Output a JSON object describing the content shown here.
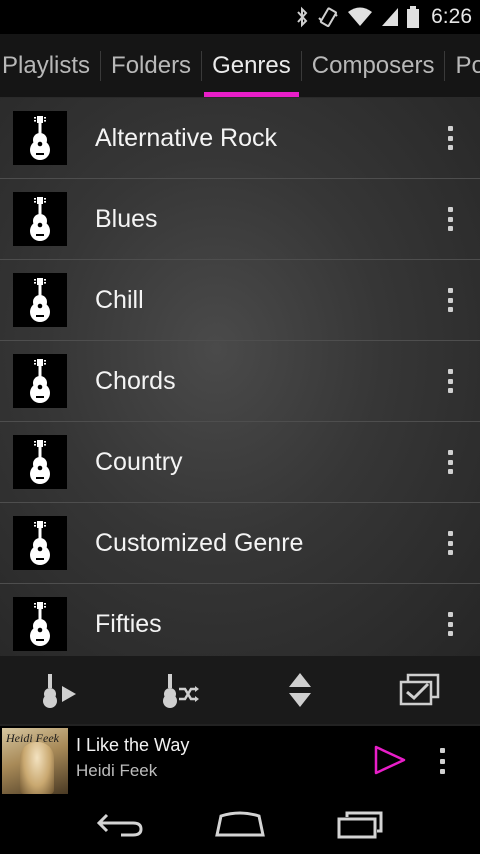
{
  "status_bar": {
    "time": "6:26",
    "icons": [
      "bluetooth-icon",
      "vibrate-icon",
      "wifi-icon",
      "signal-icon",
      "battery-icon"
    ]
  },
  "tabs": [
    {
      "label": "Playlists",
      "active": false
    },
    {
      "label": "Folders",
      "active": false
    },
    {
      "label": "Genres",
      "active": true
    },
    {
      "label": "Composers",
      "active": false
    },
    {
      "label": "Podcasts",
      "active": false
    }
  ],
  "colors": {
    "accent": "#e81ec8",
    "list_background": "#363636",
    "row_divider": "#4e4e4e"
  },
  "genres": [
    {
      "label": "Alternative Rock",
      "icon": "guitar-icon"
    },
    {
      "label": "Blues",
      "icon": "guitar-icon"
    },
    {
      "label": "Chill",
      "icon": "guitar-icon"
    },
    {
      "label": "Chords",
      "icon": "guitar-icon"
    },
    {
      "label": "Country",
      "icon": "guitar-icon"
    },
    {
      "label": "Customized Genre",
      "icon": "guitar-icon"
    },
    {
      "label": "Fifties",
      "icon": "guitar-icon"
    }
  ],
  "action_bar": {
    "buttons": [
      "play-genre-icon",
      "shuffle-genre-icon",
      "sort-icon",
      "multi-select-icon"
    ]
  },
  "now_playing": {
    "title": "I Like the Way",
    "artist": "Heidi Feek",
    "album_art_text": "Heidi Feek"
  },
  "nav_bar": {
    "buttons": [
      "back-icon",
      "home-icon",
      "recent-apps-icon"
    ]
  }
}
